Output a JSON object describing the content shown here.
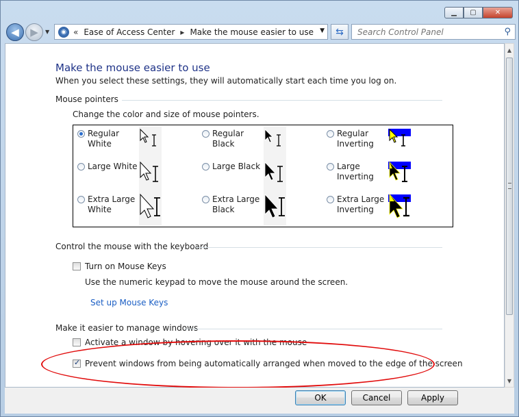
{
  "window": {
    "minimize_icon": "minimize-icon",
    "maximize_icon": "maximize-icon",
    "close_icon": "close-icon"
  },
  "toolbar": {
    "breadcrumb": [
      "Ease of Access Center",
      "Make the mouse easier to use"
    ],
    "search_placeholder": "Search Control Panel"
  },
  "page": {
    "title": "Make the mouse easier to use",
    "subtitle": "When you select these settings, they will automatically start each time you log on."
  },
  "pointers": {
    "heading": "Mouse pointers",
    "description": "Change the color and size of mouse pointers.",
    "options": [
      {
        "label": "Regular White",
        "selected": true
      },
      {
        "label": "Regular Black",
        "selected": false
      },
      {
        "label": "Regular Inverting",
        "selected": false
      },
      {
        "label": "Large White",
        "selected": false
      },
      {
        "label": "Large Black",
        "selected": false
      },
      {
        "label": "Large Inverting",
        "selected": false
      },
      {
        "label": "Extra Large White",
        "selected": false
      },
      {
        "label": "Extra Large Black",
        "selected": false
      },
      {
        "label": "Extra Large Inverting",
        "selected": false
      }
    ]
  },
  "keyboard": {
    "heading": "Control the mouse with the keyboard",
    "mouse_keys_label": "Turn on Mouse Keys",
    "mouse_keys_checked": false,
    "mouse_keys_desc": "Use the numeric keypad to move the mouse around the screen.",
    "setup_link": "Set up Mouse Keys"
  },
  "windows": {
    "heading": "Make it easier to manage windows",
    "hover_label": "Activate a window by hovering over it with the mouse",
    "hover_checked": false,
    "arrange_label": "Prevent windows from being automatically arranged when moved to the edge of the screen",
    "arrange_checked": true
  },
  "buttons": {
    "ok": "OK",
    "cancel": "Cancel",
    "apply": "Apply"
  },
  "colors": {
    "title": "#1e3287",
    "link": "#1a5ec4",
    "annotation": "#e10b0b"
  }
}
